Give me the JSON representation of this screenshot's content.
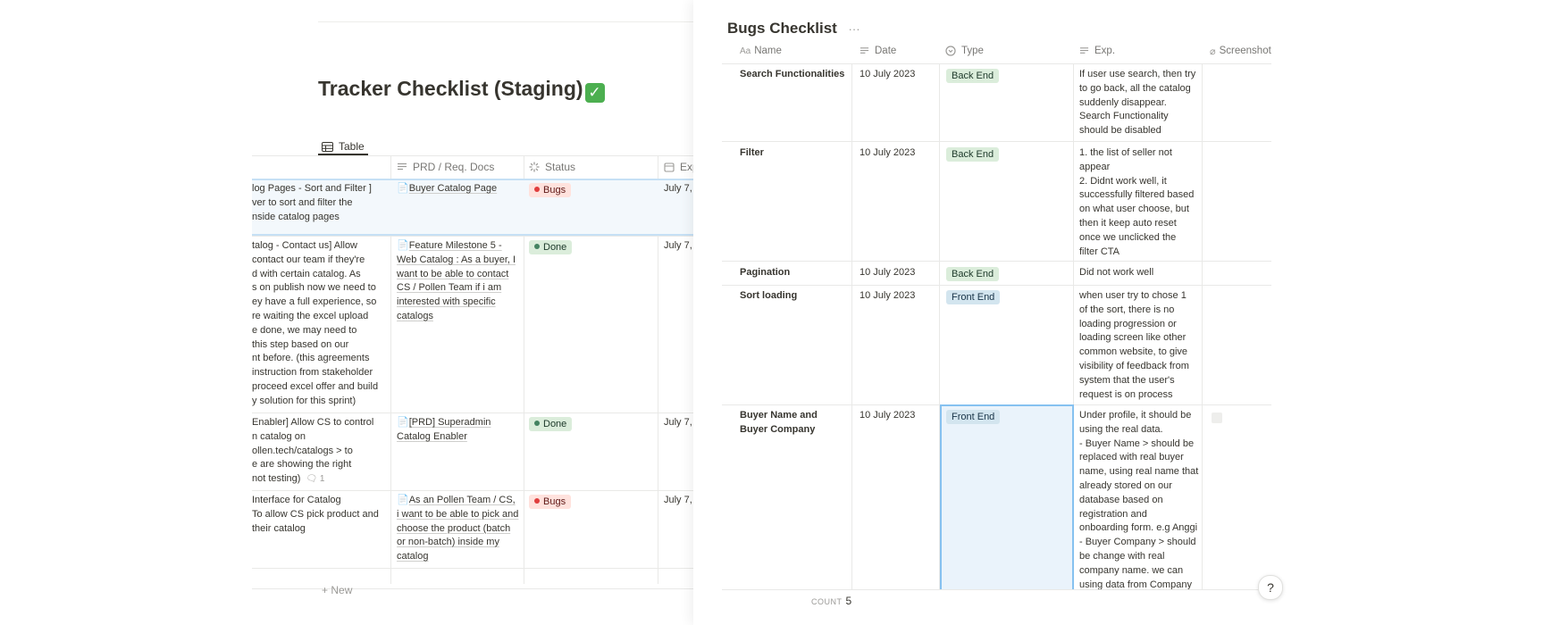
{
  "left": {
    "title": "Tracker Checklist (Staging)",
    "title_emoji": "✓",
    "view_tab": "Table",
    "columns": {
      "prd": "PRD / Req. Docs",
      "status": "Status",
      "exp": "Exp"
    },
    "rows": [
      {
        "lines": [
          "log Pages - Sort and Filter ]",
          "ver to sort and filter the",
          "nside catalog pages"
        ],
        "doc": "Buyer Catalog Page",
        "status": "Bugs",
        "date": "July 7,"
      },
      {
        "lines": [
          "talog - Contact us] Allow",
          "contact our team if they're",
          "d with certain catalog. As",
          "s on publish now we need to",
          "ey have a full experience, so",
          "re waiting the excel upload",
          "e done, we may need to",
          "this step based on our",
          "nt before. (this agreements",
          " instruction from stakeholder",
          " proceed excel offer and build",
          "y solution for this sprint)"
        ],
        "doc": "Feature Milestone 5 - Web Catalog : As a buyer, I want to be able to contact CS / Pollen Team if i am interested with specific catalogs",
        "status": "Done",
        "date": "July 7,"
      },
      {
        "lines": [
          "Enabler] Allow CS to control",
          "n catalog on",
          "ollen.tech/catalogs > to",
          "e are showing the right",
          "not testing)"
        ],
        "comment_count": "1",
        "doc": "[PRD] Superadmin Catalog Enabler",
        "status": "Done",
        "date": "July 7,"
      },
      {
        "lines": [
          " Interface for Catalog",
          " To allow CS pick product and",
          " their catalog"
        ],
        "doc": "As an Pollen Team / CS, i want to be able to pick and choose the product (batch or non-batch) inside my catalog",
        "status": "Bugs",
        "date": "July 7,"
      }
    ],
    "new_label": "New"
  },
  "right": {
    "title": "Bugs Checklist",
    "more": "···",
    "columns": {
      "name": "Name",
      "date": "Date",
      "type": "Type",
      "exp": "Exp.",
      "screenshot": "Screenshot bugs"
    },
    "rows": [
      {
        "name": "Search Functionalities",
        "date": "10 July 2023",
        "type": "Back End",
        "exp": [
          "If user use search, then try",
          "to go back, all the catalog",
          "suddenly disappear.",
          "Search Functionality",
          "should be disabled"
        ]
      },
      {
        "name": "Filter",
        "date": "10 July 2023",
        "type": "Back End",
        "exp": [
          "1. the list of seller not",
          "appear",
          "2.  Didnt work well, it",
          "successfully filtered based",
          "on what user choose, but",
          "then it keep auto reset",
          "once we unclicked the",
          "filter CTA"
        ]
      },
      {
        "name": "Pagination",
        "date": "10 July 2023",
        "type": "Back End",
        "exp": [
          "Did not work well"
        ]
      },
      {
        "name": "Sort loading",
        "date": "10 July 2023",
        "type": "Front End",
        "exp": [
          "when user try to chose 1",
          "of the sort, there is no",
          "loading progression or",
          "loading screen like other",
          "common website, to give",
          "visibility of feedback from",
          "system that the user's",
          "request is on process"
        ]
      },
      {
        "name": "Buyer Name and Buyer Company",
        "date": "10 July 2023",
        "type": "Front End",
        "exp": [
          "Under profile, it should be",
          "using the real data.",
          "- Buyer Name > should be",
          "replaced with real buyer",
          "name, using real name that",
          "already stored on our",
          "database based on",
          "registration and",
          "onboarding form. e.g Anggi",
          "- Buyer Company > should",
          "be change with real",
          "company name. we can",
          "using data from Company"
        ]
      }
    ],
    "count_label": "COUNT",
    "count_value": "5",
    "help": "?"
  }
}
